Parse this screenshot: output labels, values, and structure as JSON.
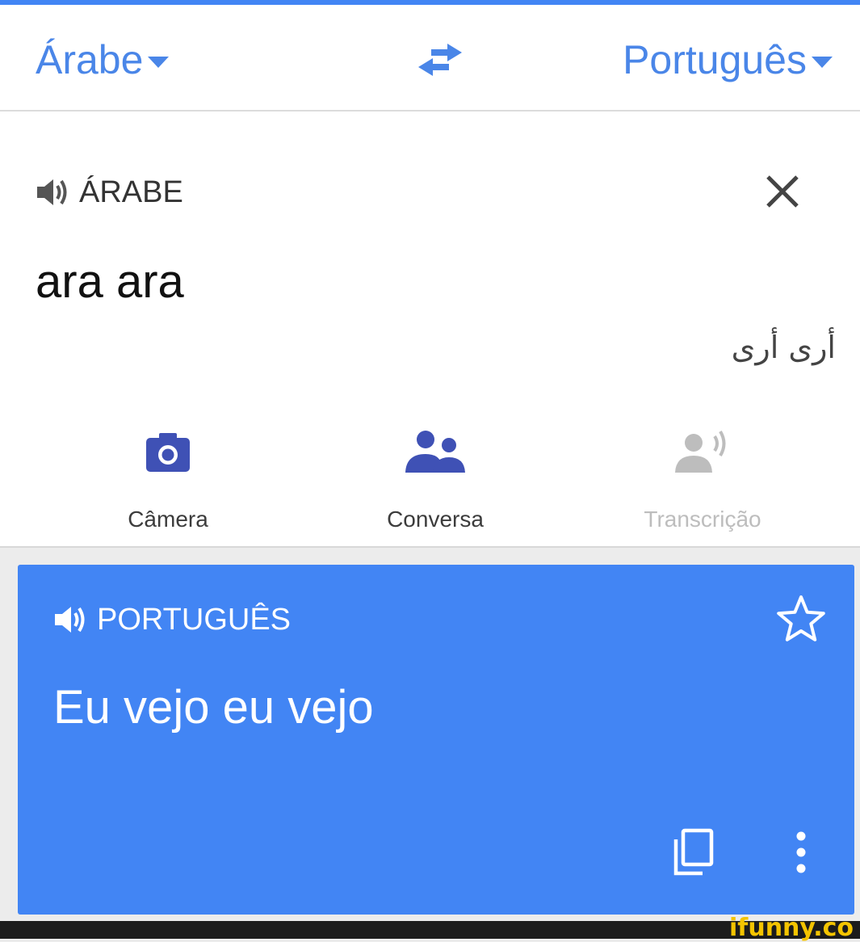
{
  "header": {
    "source_language": "Árabe",
    "target_language": "Português"
  },
  "input": {
    "language_label": "ÁRABE",
    "text": "ara ara",
    "transliteration": "أرى أرى"
  },
  "tools": [
    {
      "label": "Câmera",
      "icon": "camera-icon",
      "enabled": true
    },
    {
      "label": "Conversa",
      "icon": "people-icon",
      "enabled": true
    },
    {
      "label": "Transcrição",
      "icon": "transcribe-icon",
      "enabled": false
    }
  ],
  "result": {
    "language_label": "PORTUGUÊS",
    "text": "Eu vejo eu vejo"
  },
  "watermark": "ifunny.co",
  "colors": {
    "accent": "#4285f4",
    "tool_icon": "#3f51b5",
    "disabled": "#bdbdbd"
  }
}
